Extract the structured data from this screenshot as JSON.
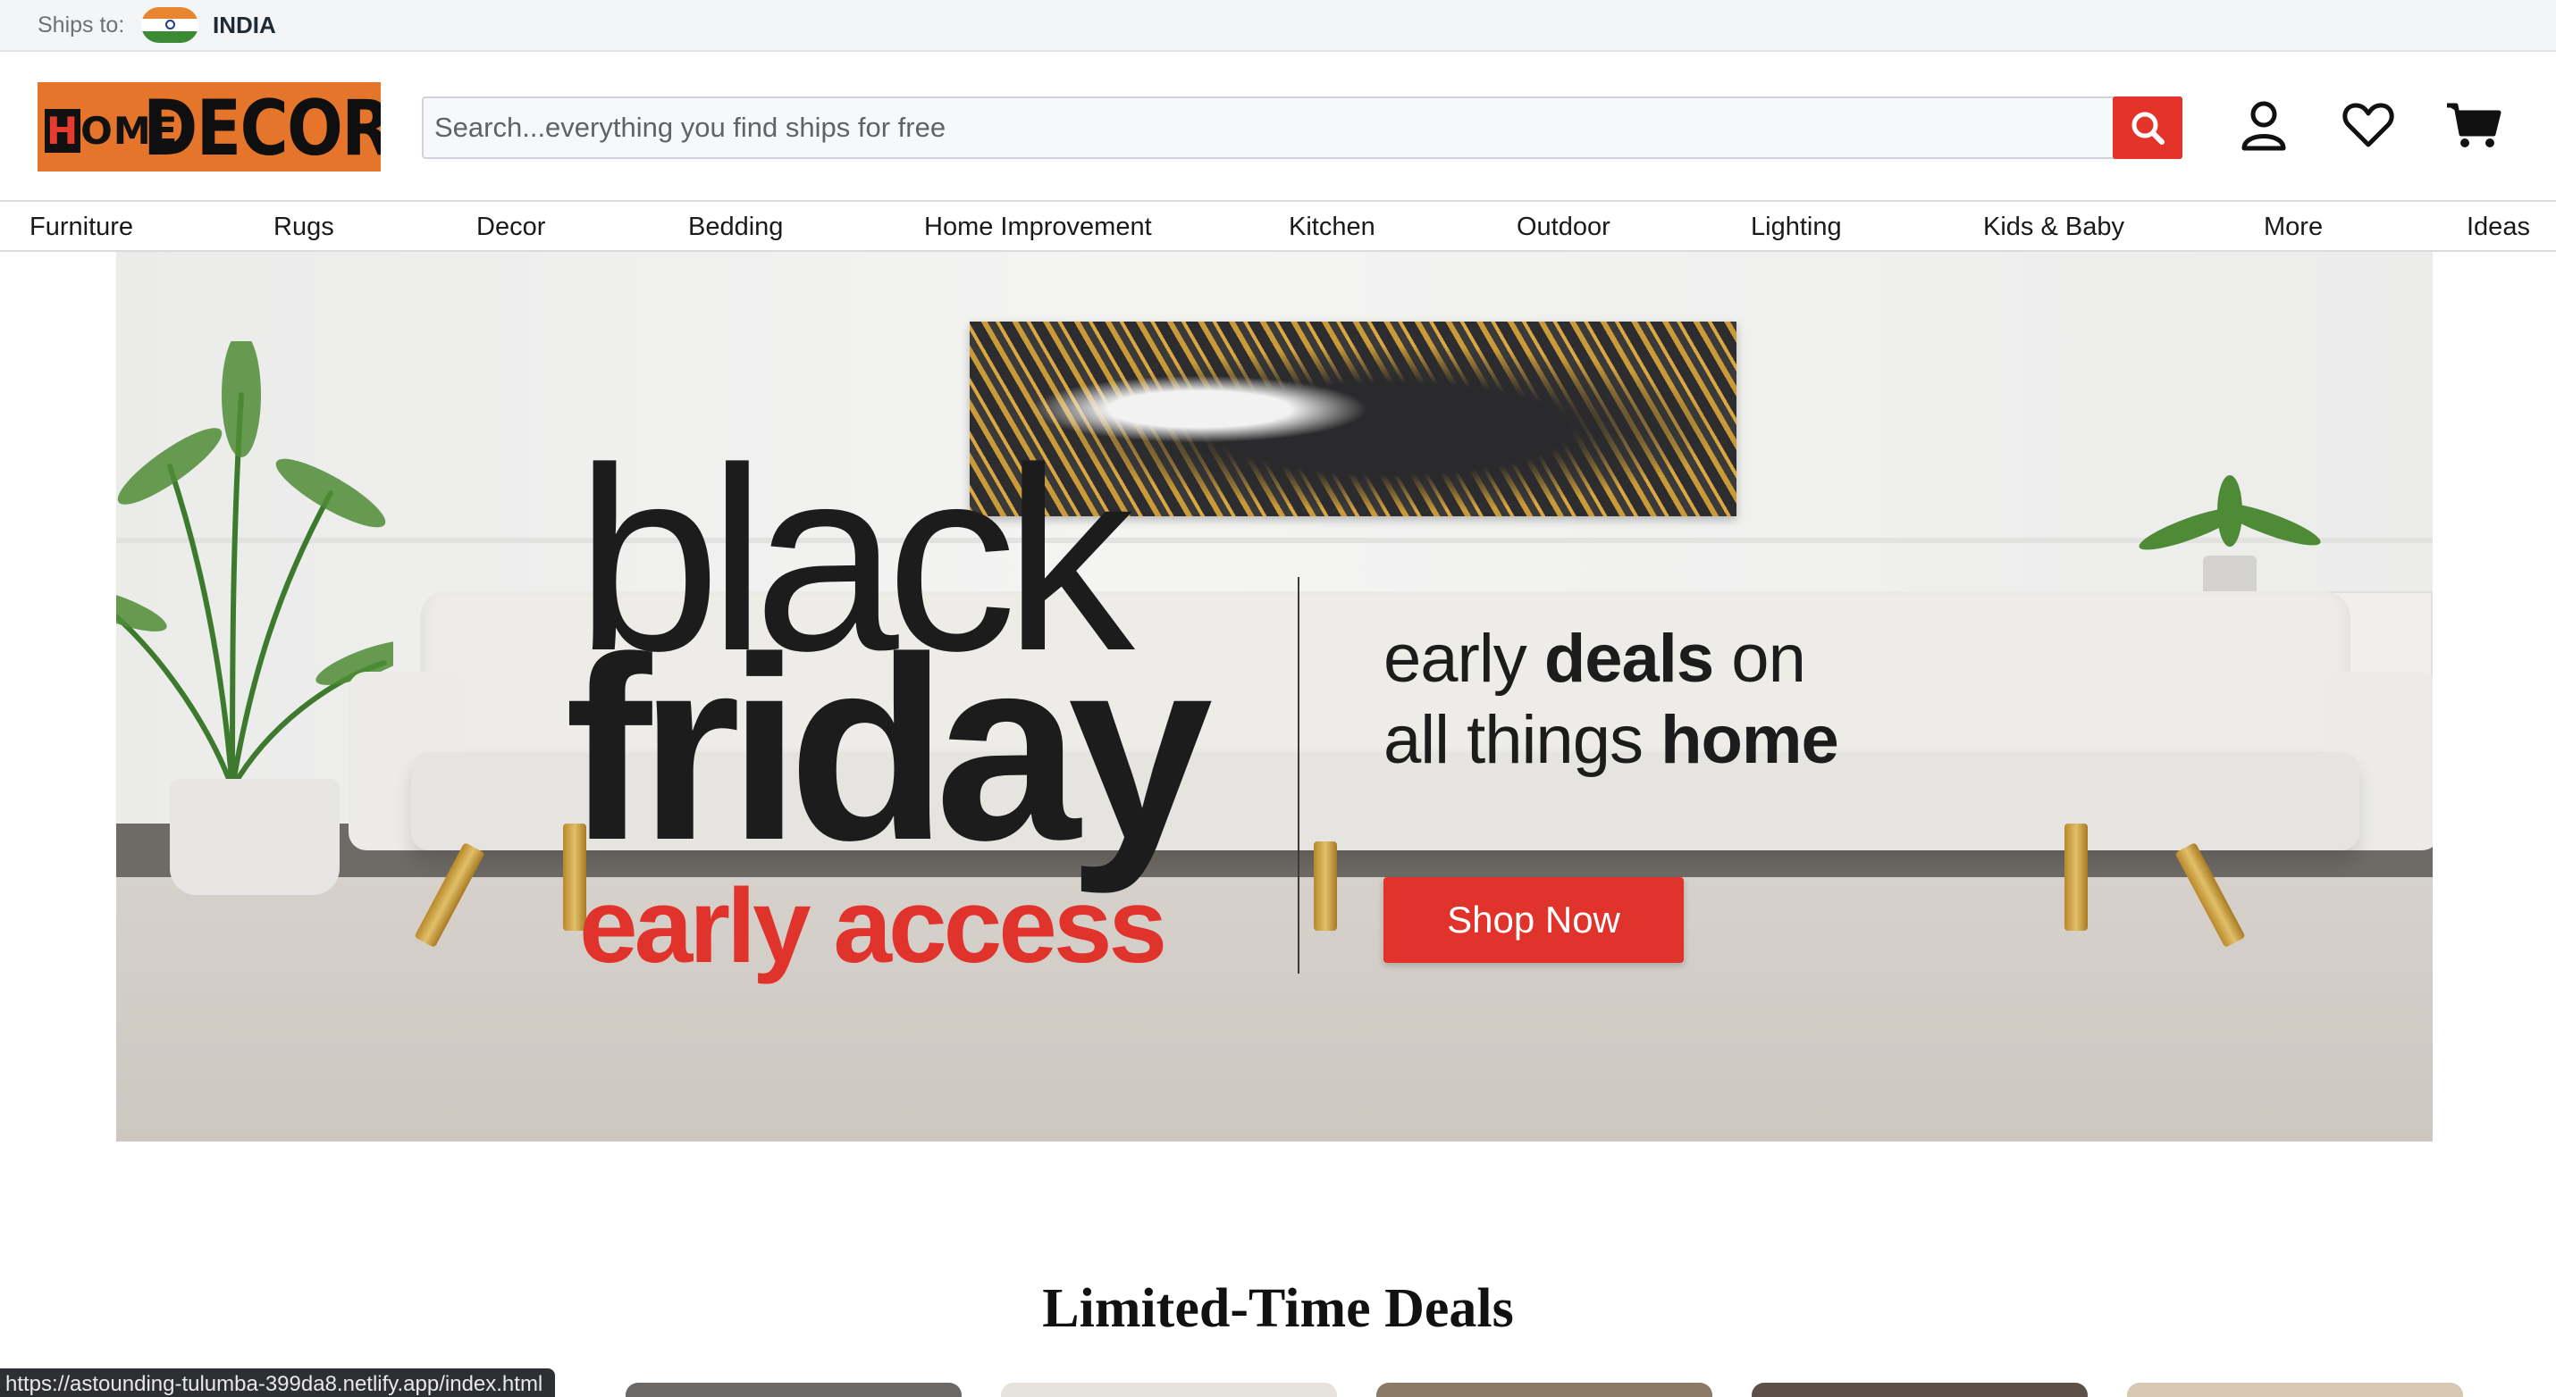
{
  "shipbar": {
    "label": "Ships to:",
    "country": "INDIA",
    "flag_icon": "india-flag-icon"
  },
  "header": {
    "logo_home": "HOME",
    "logo_decor": "DECOR",
    "search_placeholder": "Search...everything you find ships for free",
    "search_icon": "search-icon",
    "account_icon": "user-icon",
    "wishlist_icon": "heart-icon",
    "cart_icon": "cart-icon"
  },
  "nav": {
    "items": [
      "Furniture",
      "Rugs",
      "Decor",
      "Bedding",
      "Home Improvement",
      "Kitchen",
      "Outdoor",
      "Lighting",
      "Kids & Baby",
      "More",
      "Ideas"
    ]
  },
  "hero": {
    "line1": "black",
    "line2": "friday",
    "line3": "early access",
    "tag_1a": "early ",
    "tag_1b": "deals",
    "tag_1c": " on",
    "tag_2a": "all things ",
    "tag_2b": "home",
    "button": "Shop Now"
  },
  "deals": {
    "title": "Limited-Time Deals"
  },
  "status": {
    "url": "https://astounding-tulumba-399da8.netlify.app/index.html"
  },
  "colors": {
    "accent": "#e4332a",
    "logo_bg": "#e5752b"
  }
}
